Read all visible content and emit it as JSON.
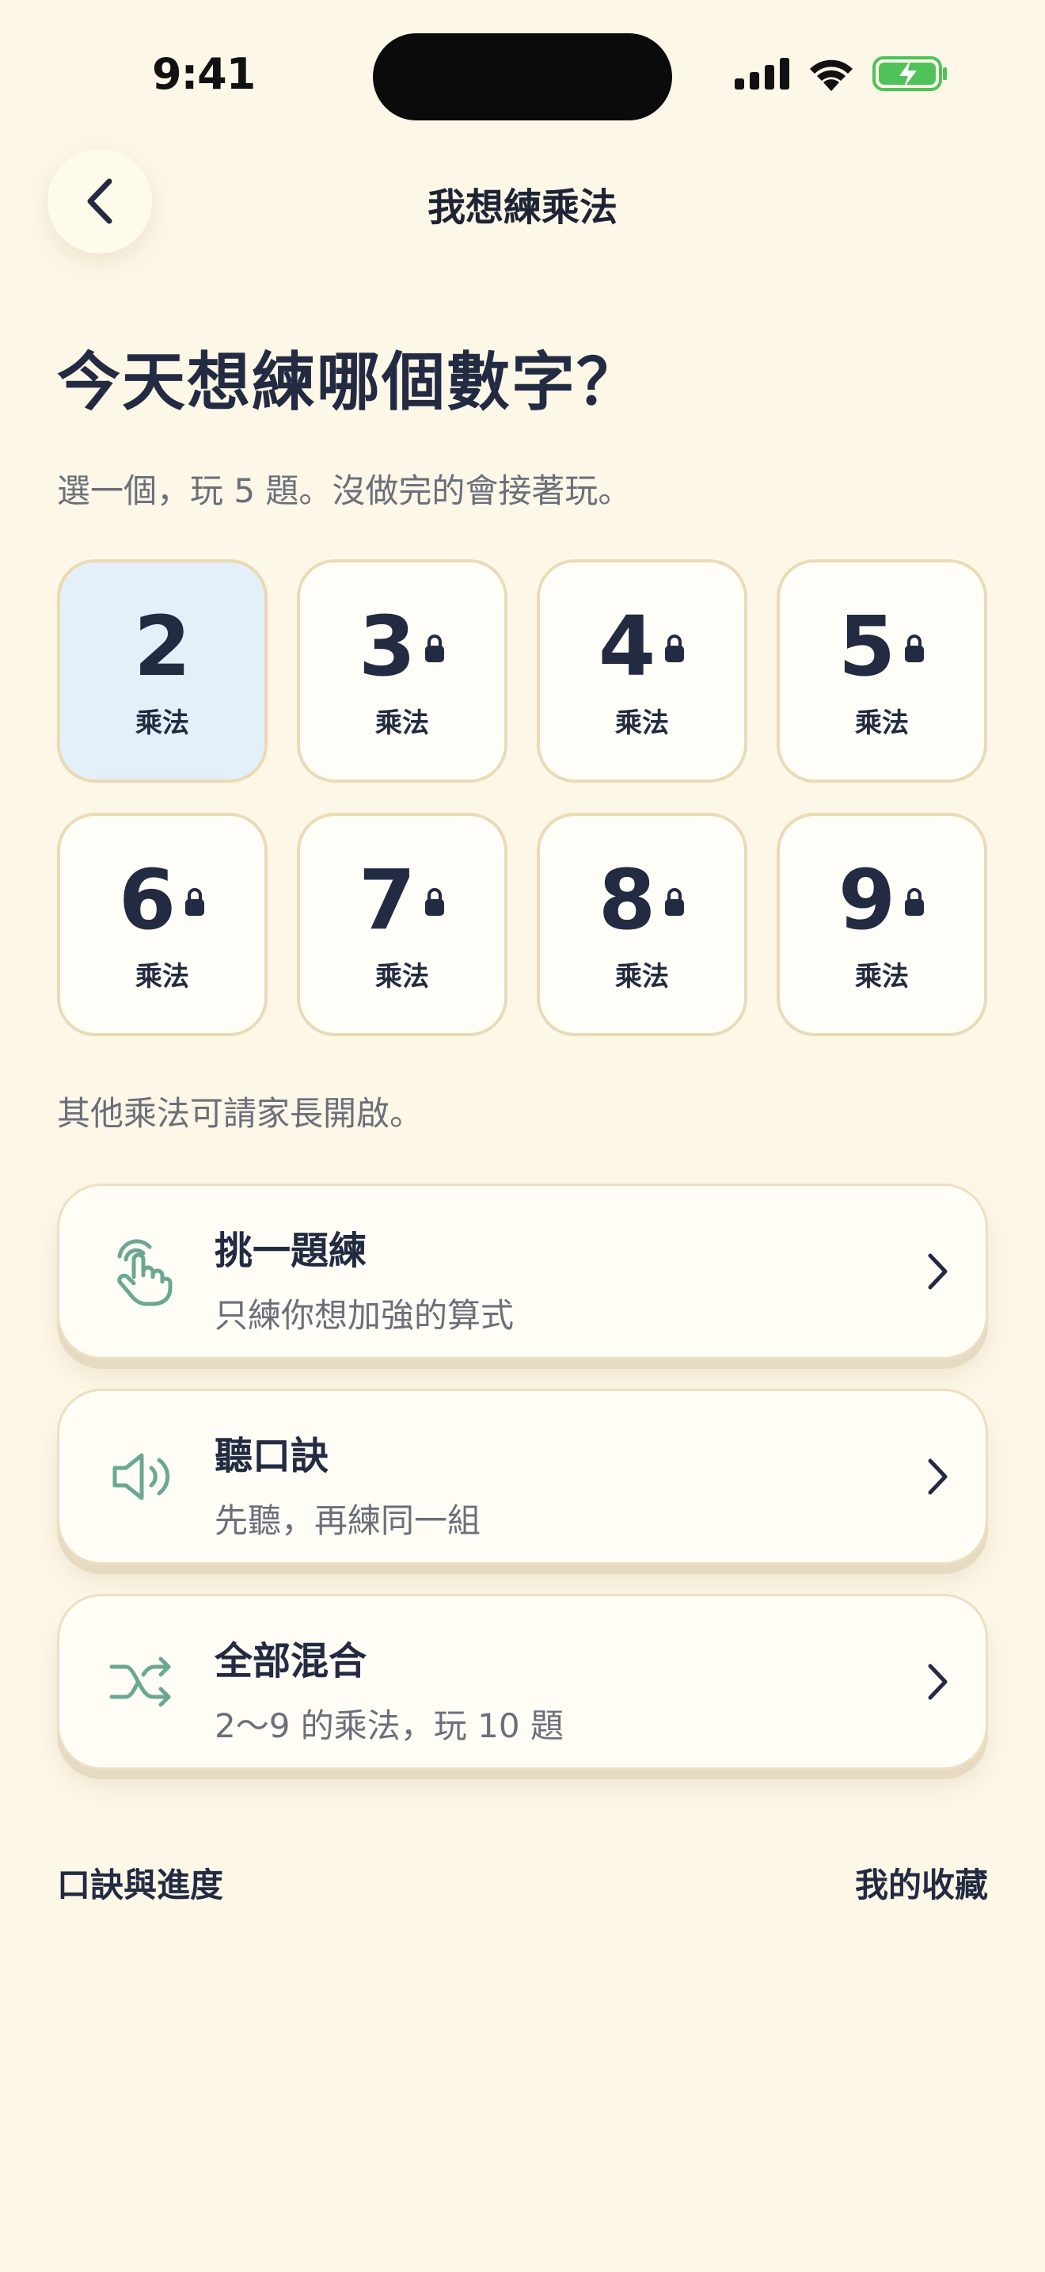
{
  "status_bar": {
    "time": "9:41",
    "signal_icon": "cellular-signal-icon",
    "wifi_icon": "wifi-icon",
    "battery_icon": "battery-charging-icon"
  },
  "header": {
    "title": "我想練乘法",
    "back_icon": "chevron-left-icon"
  },
  "main": {
    "headline": "今天想練哪個數字？",
    "subline": "選一個，玩 5 題。沒做完的會接著玩。",
    "tiles": [
      {
        "number": "2",
        "label": "乘法",
        "locked": false,
        "selected": true
      },
      {
        "number": "3",
        "label": "乘法",
        "locked": true,
        "selected": false
      },
      {
        "number": "4",
        "label": "乘法",
        "locked": true,
        "selected": false
      },
      {
        "number": "5",
        "label": "乘法",
        "locked": true,
        "selected": false
      },
      {
        "number": "6",
        "label": "乘法",
        "locked": true,
        "selected": false
      },
      {
        "number": "7",
        "label": "乘法",
        "locked": true,
        "selected": false
      },
      {
        "number": "8",
        "label": "乘法",
        "locked": true,
        "selected": false
      },
      {
        "number": "9",
        "label": "乘法",
        "locked": true,
        "selected": false
      }
    ],
    "note": "其他乘法可請家長開啟。",
    "options": [
      {
        "title": "挑一題練",
        "subtitle": "只練你想加強的算式",
        "icon": "tap-hand-icon"
      },
      {
        "title": "聽口訣",
        "subtitle": "先聽，再練同一組",
        "icon": "speaker-icon"
      },
      {
        "title": "全部混合",
        "subtitle": "2～9 的乘法，玩 10 題",
        "icon": "shuffle-icon"
      }
    ]
  },
  "footer": {
    "left_link": "口訣與進度",
    "right_link": "我的收藏"
  },
  "colors": {
    "background": "#fdf7e8",
    "accent_green": "#6aa893",
    "selected_tile": "#e3f0f9",
    "text_dark": "#222b42"
  }
}
